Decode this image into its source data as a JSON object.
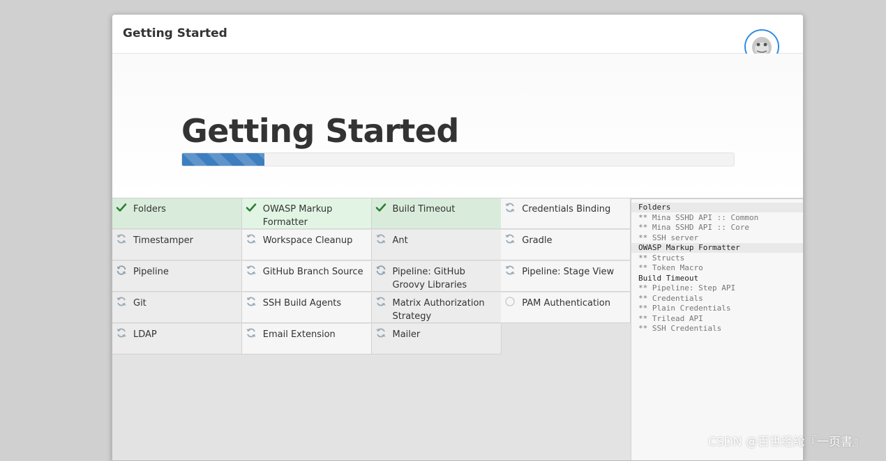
{
  "dialog": {
    "title": "Getting Started"
  },
  "hero": {
    "title": "Getting Started",
    "progress_fraction": 0.149
  },
  "plugins": [
    {
      "label": "Folders",
      "status": "done"
    },
    {
      "label": "OWASP Markup Formatter",
      "status": "done"
    },
    {
      "label": "Build Timeout",
      "status": "done"
    },
    {
      "label": "Credentials Binding",
      "status": "pending"
    },
    {
      "label": "Timestamper",
      "status": "pending"
    },
    {
      "label": "Workspace Cleanup",
      "status": "pending"
    },
    {
      "label": "Ant",
      "status": "pending"
    },
    {
      "label": "Gradle",
      "status": "pending"
    },
    {
      "label": "Pipeline",
      "status": "installing"
    },
    {
      "label": "GitHub Branch Source",
      "status": "pending"
    },
    {
      "label": "Pipeline: GitHub Groovy Libraries",
      "status": "installing"
    },
    {
      "label": "Pipeline: Stage View",
      "status": "pending"
    },
    {
      "label": "Git",
      "status": "pending"
    },
    {
      "label": "SSH Build Agents",
      "status": "pending"
    },
    {
      "label": "Matrix Authorization Strategy",
      "status": "pending"
    },
    {
      "label": "PAM Authentication",
      "status": "idle"
    },
    {
      "label": "LDAP",
      "status": "pending"
    },
    {
      "label": "Email Extension",
      "status": "pending"
    },
    {
      "label": "Mailer",
      "status": "pending"
    }
  ],
  "log": [
    {
      "text": "Folders",
      "kind": "head"
    },
    {
      "text": "** Mina SSHD API :: Common",
      "kind": "dep"
    },
    {
      "text": "** Mina SSHD API :: Core",
      "kind": "dep"
    },
    {
      "text": "** SSH server",
      "kind": "dep"
    },
    {
      "text": "OWASP Markup Formatter",
      "kind": "head"
    },
    {
      "text": "** Structs",
      "kind": "dep"
    },
    {
      "text": "** Token Macro",
      "kind": "dep"
    },
    {
      "text": "Build Timeout",
      "kind": "head"
    },
    {
      "text": "** Pipeline: Step API",
      "kind": "dep"
    },
    {
      "text": "** Credentials",
      "kind": "dep"
    },
    {
      "text": "** Plain Credentials",
      "kind": "dep"
    },
    {
      "text": "** Trilead API",
      "kind": "dep"
    },
    {
      "text": "** SSH Credentials",
      "kind": "dep"
    }
  ],
  "watermark": "CSDN @百世经纶『一页書』",
  "colors": {
    "progress": "#3d7ebf",
    "check": "#2e7d32",
    "spinner": "#9aaab6",
    "avatar_ring": "#2d8ae6"
  }
}
